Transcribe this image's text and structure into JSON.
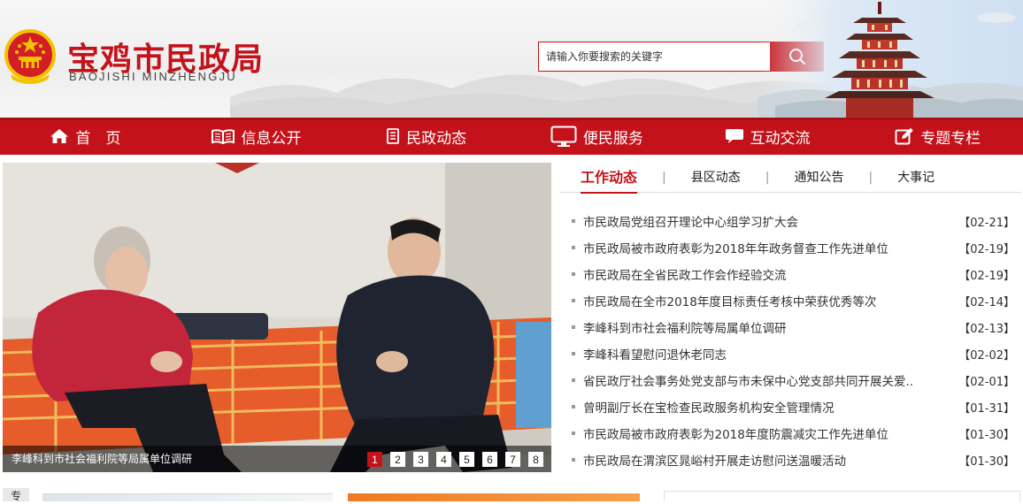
{
  "header": {
    "title_cn": "宝鸡市民政局",
    "title_en": "BAOJISHI MINZHENGJU",
    "search_placeholder": "请输入你要搜索的关键字",
    "icons": {
      "emblem": "national-emblem",
      "search": "search-icon",
      "pagoda": "pagoda-illustration"
    }
  },
  "nav": {
    "items": [
      {
        "label": "首　页",
        "icon": "home-icon"
      },
      {
        "label": "信息公开",
        "icon": "book-icon"
      },
      {
        "label": "民政动态",
        "icon": "document-icon"
      },
      {
        "label": "便民服务",
        "icon": "monitor-icon"
      },
      {
        "label": "互动交流",
        "icon": "chat-icon"
      },
      {
        "label": "专题专栏",
        "icon": "edit-icon"
      }
    ]
  },
  "slider": {
    "caption": "李峰科到市社会福利院等局属单位调研",
    "pages": [
      "1",
      "2",
      "3",
      "4",
      "5",
      "6",
      "7",
      "8"
    ],
    "active_page": 1
  },
  "news": {
    "tabs": [
      {
        "label": "工作动态"
      },
      {
        "label": "县区动态"
      },
      {
        "label": "通知公告"
      },
      {
        "label": "大事记"
      }
    ],
    "active_tab": 0,
    "items": [
      {
        "title": "市民政局党组召开理论中心组学习扩大会",
        "date": "【02-21】"
      },
      {
        "title": "市民政局被市政府表彰为2018年年政务督查工作先进单位",
        "date": "【02-19】"
      },
      {
        "title": "市民政局在全省民政工作会作经验交流",
        "date": "【02-19】"
      },
      {
        "title": "市民政局在全市2018年度目标责任考核中荣获优秀等次",
        "date": "【02-14】"
      },
      {
        "title": "李峰科到市社会福利院等局属单位调研",
        "date": "【02-13】"
      },
      {
        "title": "李峰科看望慰问退休老同志",
        "date": "【02-02】"
      },
      {
        "title": "省民政厅社会事务处党支部与市未保中心党支部共同开展关爱..",
        "date": "【02-01】"
      },
      {
        "title": "曾明副厅长在宝检查民政服务机构安全管理情况",
        "date": "【01-31】"
      },
      {
        "title": "市民政局被市政府表彰为2018年度防震减灾工作先进单位",
        "date": "【01-30】"
      },
      {
        "title": "市民政局在渭滨区晁峪村开展走访慰问送温暖活动",
        "date": "【01-30】"
      }
    ]
  },
  "bottom": {
    "label": "专"
  },
  "colors": {
    "brand_red": "#c4121a",
    "nav_red": "#c4121a",
    "text": "#333333"
  }
}
